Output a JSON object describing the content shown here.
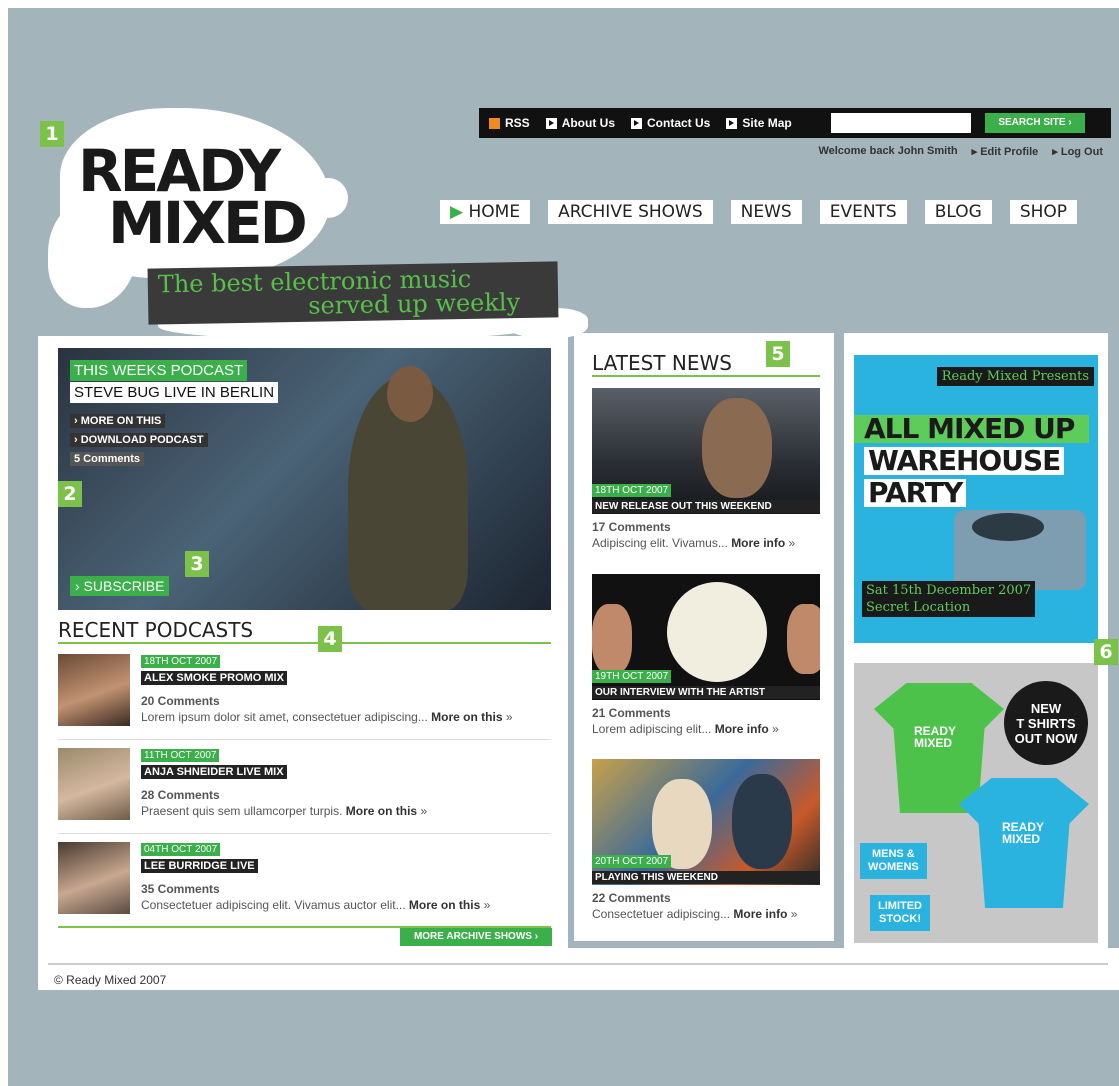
{
  "markers": [
    "1",
    "2",
    "3",
    "4",
    "5",
    "6"
  ],
  "brand": {
    "logo_line1": "READY",
    "logo_line2": "MIXED",
    "tagline_line1": "The best electronic music",
    "tagline_line2": "served up weekly"
  },
  "topbar": {
    "links": [
      "RSS",
      "About Us",
      "Contact Us",
      "Site Map"
    ],
    "search_placeholder": "",
    "search_button": "SEARCH SITE ›"
  },
  "userbar": {
    "welcome": "Welcome back John Smith",
    "edit_profile": "▸ Edit Profile",
    "logout": "▸ Log Out"
  },
  "nav": [
    "HOME",
    "ARCHIVE SHOWS",
    "NEWS",
    "EVENTS",
    "BLOG",
    "SHOP"
  ],
  "feature": {
    "kicker": "THIS WEEKS PODCAST",
    "title": "STEVE BUG LIVE IN BERLIN",
    "more": "› MORE ON THIS",
    "download": "› DOWNLOAD PODCAST",
    "comments": "5 Comments",
    "subscribe": "› SUBSCRIBE"
  },
  "recent": {
    "title": "RECENT PODCASTS",
    "items": [
      {
        "date": "18TH OCT 2007",
        "name": "ALEX SMOKE PROMO MIX",
        "comments": "20 Comments",
        "text": "Lorem ipsum dolor sit amet, consectetuer adipiscing...",
        "more": "More on this",
        "chevron": "»"
      },
      {
        "date": "11TH OCT 2007",
        "name": "ANJA SHNEIDER LIVE MIX",
        "comments": "28 Comments",
        "text": "Praesent quis sem ullamcorper turpis.",
        "more": "More on this",
        "chevron": "»"
      },
      {
        "date": "04TH OCT 2007",
        "name": "LEE BURRIDGE LIVE",
        "comments": "35 Comments",
        "text": "Consectetuer adipiscing elit. Vivamus auctor elit...",
        "more": "More on this",
        "chevron": "»"
      }
    ],
    "archive_button": "MORE ARCHIVE SHOWS ›"
  },
  "news": {
    "title": "LATEST NEWS",
    "items": [
      {
        "date": "18TH OCT 2007",
        "headline": "NEW RELEASE OUT THIS WEEKEND",
        "comments": "17 Comments",
        "text": "Adipiscing elit. Vivamus...",
        "more": "More info",
        "chevron": "»"
      },
      {
        "date": "19TH OCT 2007",
        "headline": "OUR INTERVIEW WITH THE ARTIST",
        "comments": "21 Comments",
        "text": "Lorem adipiscing elit...",
        "more": "More info",
        "chevron": "»"
      },
      {
        "date": "20TH OCT 2007",
        "headline": "PLAYING THIS WEEKEND",
        "comments": "22 Comments",
        "text": "Consectetuer adipiscing...",
        "more": "More info",
        "chevron": "»"
      }
    ]
  },
  "promo": {
    "presents": "Ready Mixed Presents",
    "line1": "ALL MIXED UP",
    "line2": "WAREHOUSE",
    "line3": "PARTY",
    "date": "Sat 15th December 2007",
    "location": "Secret Location"
  },
  "shop": {
    "badge_line1": "NEW",
    "badge_line2": "T SHIRTS",
    "badge_line3": "OUT NOW",
    "mens_line1": "MENS &",
    "mens_line2": "WOMENS",
    "stock_line1": "LIMITED",
    "stock_line2": "STOCK!",
    "shirt_logo_line1": "READY",
    "shirt_logo_line2": "MIXED"
  },
  "footer": {
    "copyright": "© Ready Mixed 2007"
  },
  "colors": {
    "accent": "#3bb04a",
    "background": "#a3b5bb",
    "promo_blue": "#29b3de"
  }
}
